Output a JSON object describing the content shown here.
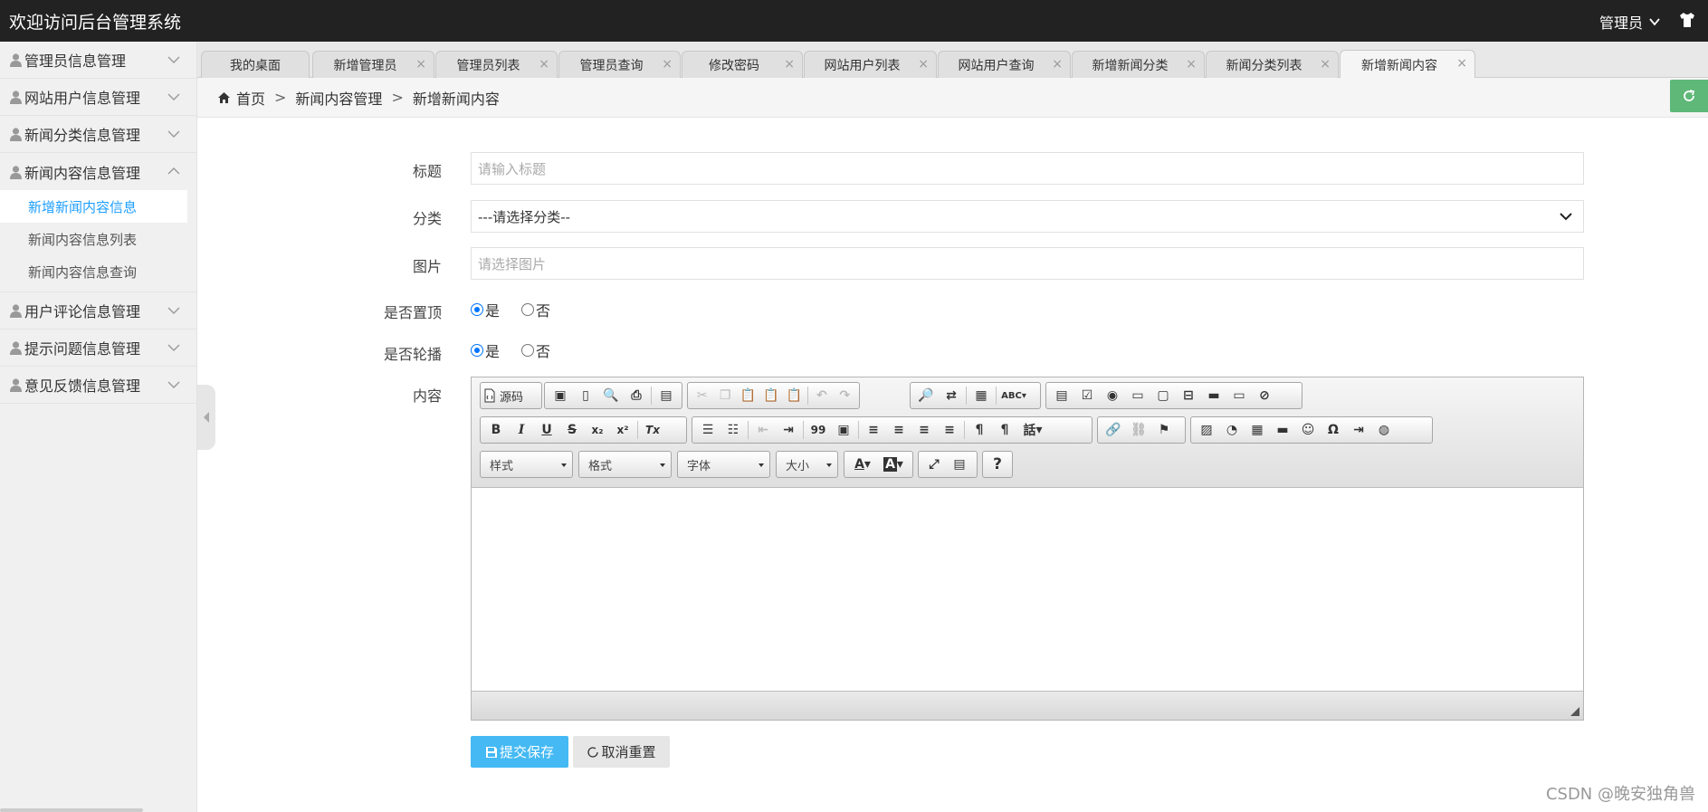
{
  "header": {
    "title": "欢迎访问后台管理系统",
    "user_label": "管理员"
  },
  "sidebar": {
    "groups": [
      {
        "label": "管理员信息管理"
      },
      {
        "label": "网站用户信息管理"
      },
      {
        "label": "新闻分类信息管理"
      },
      {
        "label": "新闻内容信息管理",
        "expanded": true,
        "items": [
          {
            "label": "新增新闻内容信息",
            "active": true
          },
          {
            "label": "新闻内容信息列表"
          },
          {
            "label": "新闻内容信息查询"
          }
        ]
      },
      {
        "label": "用户评论信息管理"
      },
      {
        "label": "提示问题信息管理"
      },
      {
        "label": "意见反馈信息管理"
      }
    ]
  },
  "tabs": [
    {
      "label": "我的桌面",
      "closable": false
    },
    {
      "label": "新增管理员",
      "closable": true
    },
    {
      "label": "管理员列表",
      "closable": true
    },
    {
      "label": "管理员查询",
      "closable": true
    },
    {
      "label": "修改密码",
      "closable": true
    },
    {
      "label": "网站用户列表",
      "closable": true
    },
    {
      "label": "网站用户查询",
      "closable": true
    },
    {
      "label": "新增新闻分类",
      "closable": true
    },
    {
      "label": "新闻分类列表",
      "closable": true
    },
    {
      "label": "新增新闻内容",
      "closable": true,
      "active": true
    }
  ],
  "tab_close_glyph": "×",
  "breadcrumb": {
    "home": "首页",
    "sep": ">",
    "level1": "新闻内容管理",
    "level2": "新增新闻内容"
  },
  "form": {
    "title": {
      "label": "标题",
      "placeholder": "请输入标题"
    },
    "category": {
      "label": "分类",
      "value": "---请选择分类--"
    },
    "image": {
      "label": "图片",
      "placeholder": "请选择图片"
    },
    "is_top": {
      "label": "是否置顶",
      "options": [
        "是",
        "否"
      ],
      "selected": "是"
    },
    "is_carousel": {
      "label": "是否轮播",
      "options": [
        "是",
        "否"
      ],
      "selected": "是"
    },
    "content": {
      "label": "内容"
    }
  },
  "editor": {
    "source_label": "源码",
    "combos": {
      "style": "样式",
      "format": "格式",
      "font": "字体",
      "size": "大小"
    },
    "glyphs": {
      "bold": "B",
      "italic": "I",
      "underline": "U",
      "strike": "S",
      "subscript": "x₂",
      "superscript": "x²",
      "remove_format": "Tx",
      "blockquote": "99",
      "help": "?",
      "omega": "Ω",
      "ltr": "¶",
      "language": "話",
      "spell": "ABC",
      "text_color": "A",
      "bg_color": "A"
    }
  },
  "buttons": {
    "submit": "提交保存",
    "reset": "取消重置"
  },
  "watermark": "CSDN @晚安独角兽",
  "colors": {
    "accent": "#1e9fff",
    "submit": "#44b9f3",
    "refresh": "#5fb878",
    "header": "#222222"
  }
}
